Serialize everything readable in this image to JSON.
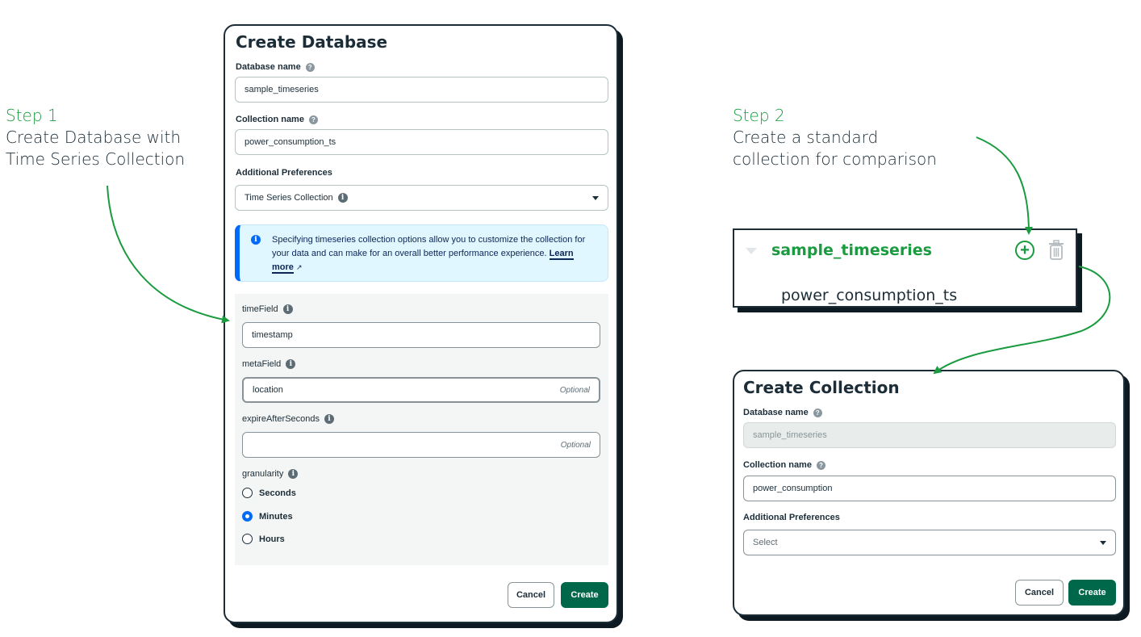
{
  "step1": {
    "num": "Step 1",
    "desc": "Create Database with\nTime Series Collection"
  },
  "step2": {
    "num": "Step 2",
    "desc": "Create a standard\ncollection for comparison"
  },
  "create_db": {
    "title": "Create Database",
    "db_label": "Database name",
    "db_value": "sample_timeseries",
    "coll_label": "Collection name",
    "coll_value": "power_consumption_ts",
    "prefs_label": "Additional Preferences",
    "prefs_value": "Time Series Collection",
    "info_text": "Specifying timeseries collection options allow you to customize the collection for your data and can make for an overall better performance experience.",
    "learn_more": "Learn more",
    "time_field_label": "timeField",
    "time_field_value": "timestamp",
    "meta_field_label": "metaField",
    "meta_field_value": "location",
    "meta_field_hint": "Optional",
    "expire_label": "expireAfterSeconds",
    "expire_value": "",
    "expire_hint": "Optional",
    "granularity_label": "granularity",
    "granularity_options": [
      "Seconds",
      "Minutes",
      "Hours"
    ],
    "granularity_selected": "Minutes",
    "cancel_label": "Cancel",
    "create_label": "Create"
  },
  "sidebar": {
    "db_name": "sample_timeseries",
    "collection": "power_consumption_ts",
    "add_icon": "plus-circle-icon",
    "delete_icon": "trash-icon"
  },
  "create_coll": {
    "title": "Create Collection",
    "db_label": "Database name",
    "db_value": "sample_timeseries",
    "coll_label": "Collection name",
    "coll_value": "power_consumption",
    "prefs_label": "Additional Preferences",
    "prefs_placeholder": "Select",
    "cancel_label": "Cancel",
    "create_label": "Create"
  },
  "colors": {
    "accent_green": "#1a9b3f",
    "button_green": "#00684a",
    "info_blue": "#016bf8"
  }
}
